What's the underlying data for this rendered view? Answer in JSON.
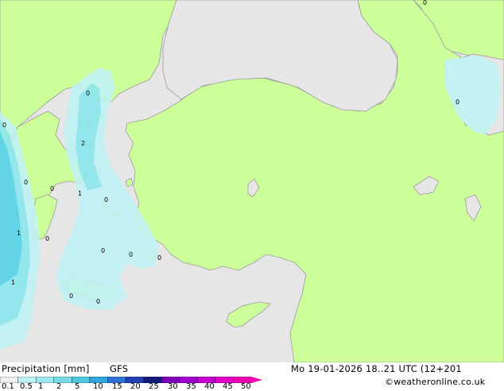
{
  "map": {
    "point_labels": [
      "0",
      "0",
      "0",
      "2",
      "0",
      "1",
      "0",
      "0",
      "1",
      "0",
      "0",
      "0",
      "0",
      "1",
      "0",
      "0",
      "0"
    ]
  },
  "footer": {
    "title": "Precipitation [mm]",
    "model": "GFS",
    "datetime": "Mo 19-01-2026 18..21 UTC (12+201",
    "credit": "©weatheronline.co.uk"
  },
  "colorbar": {
    "ticks": [
      "0.1",
      "0.5",
      "1",
      "2",
      "5",
      "10",
      "15",
      "20",
      "25",
      "30",
      "35",
      "40",
      "45",
      "50"
    ],
    "colors": [
      "#f0f0f0",
      "#bdf0f2",
      "#9ee8ef",
      "#78dbe8",
      "#4fc9e0",
      "#2fa5dc",
      "#2b72d2",
      "#2440b4",
      "#161c7f",
      "#7b00b8",
      "#a100d2",
      "#c800d6",
      "#e000c8",
      "#f000b0"
    ]
  },
  "colors": {
    "sea": "#e6e6e6",
    "land": "#ccff99",
    "border": "#9a9a9a",
    "precip_light": "#c0f2f4",
    "precip_mid": "#8ce6ee",
    "precip_heavy": "#55d3e6"
  }
}
